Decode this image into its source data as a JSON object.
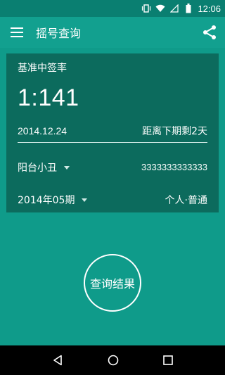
{
  "status": {
    "time": "12:06"
  },
  "appbar": {
    "title": "摇号查询",
    "menu_icon": "menu-icon",
    "share_icon": "share-icon"
  },
  "card": {
    "base_label": "基准中签率",
    "ratio": "1:141",
    "date": "2014.12.24",
    "remaining": "距离下期剩2天",
    "applicant_name": "阳台小丑",
    "code": "3333333333333",
    "period": "2014年05期",
    "type": "个人·普通"
  },
  "query_button": "查询结果",
  "colors": {
    "background": "#0f9b8a",
    "card": "#0c6b5d",
    "appbar": "#12a08f",
    "statusbar": "#0a7f71"
  }
}
